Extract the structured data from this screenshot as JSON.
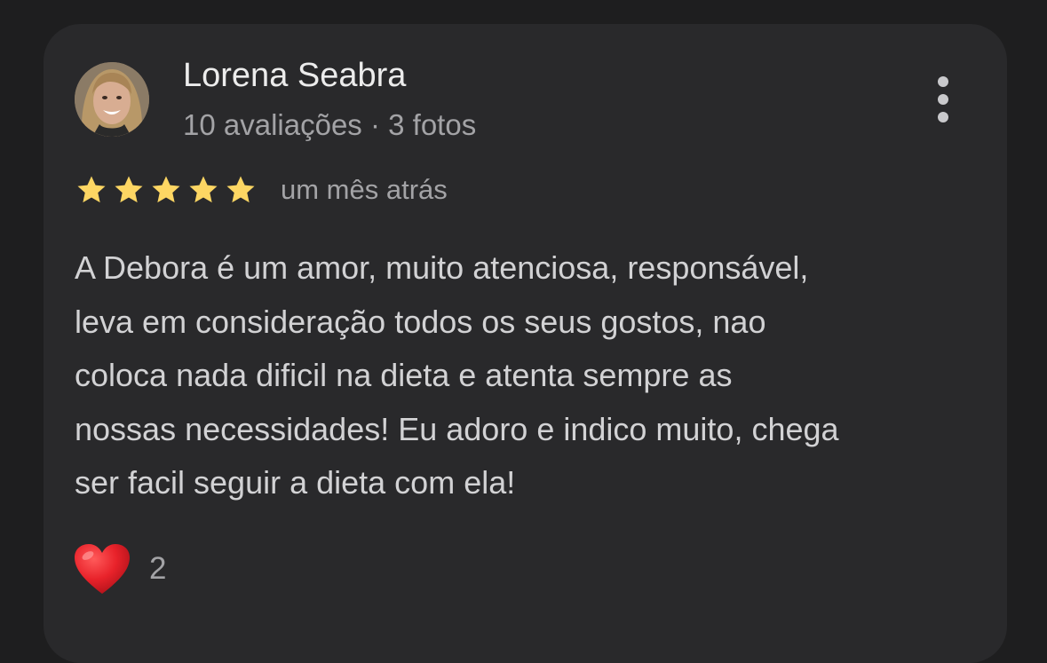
{
  "reviewer": {
    "name": "Lorena Seabra",
    "meta": "10 avaliações · 3 fotos"
  },
  "rating": {
    "stars": 5,
    "max_stars": 5,
    "star_color": "#fdd663",
    "date": "um mês atrás"
  },
  "review": {
    "lines": [
      "A Debora é um amor, muito atenciosa, responsável,",
      "leva em consideração todos os seus gostos, nao",
      "coloca nada dificil na dieta e atenta sempre as",
      "nossas necessidades! Eu adoro e indico muito, chega",
      "ser facil seguir a dieta com ela!"
    ]
  },
  "reaction": {
    "icon": "heart-icon",
    "count": "2"
  },
  "menu": {
    "icon": "more-vertical-icon"
  }
}
